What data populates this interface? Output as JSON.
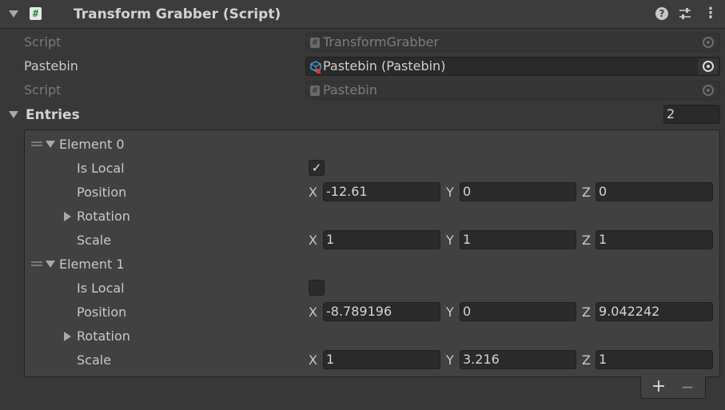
{
  "component": {
    "title": "Transform Grabber (Script)"
  },
  "fields": {
    "script_label": "Script",
    "script_value": "TransformGrabber",
    "pastebin_label": "Pastebin",
    "pastebin_value": "Pastebin (Pastebin)",
    "script2_label": "Script",
    "script2_value": "Pastebin"
  },
  "entries": {
    "label": "Entries",
    "count": "2",
    "elements": [
      {
        "label": "Element 0",
        "is_local_label": "Is Local",
        "is_local": true,
        "position_label": "Position",
        "position": {
          "x": "-12.61",
          "y": "0",
          "z": "0"
        },
        "rotation_label": "Rotation",
        "scale_label": "Scale",
        "scale": {
          "x": "1",
          "y": "1",
          "z": "1"
        }
      },
      {
        "label": "Element 1",
        "is_local_label": "Is Local",
        "is_local": false,
        "position_label": "Position",
        "position": {
          "x": "-8.789196",
          "y": "0",
          "z": "9.042242"
        },
        "rotation_label": "Rotation",
        "scale_label": "Scale",
        "scale": {
          "x": "1",
          "y": "3.216",
          "z": "1"
        }
      }
    ]
  },
  "axes": {
    "x": "X",
    "y": "Y",
    "z": "Z"
  },
  "glyphs": {
    "hash": "#",
    "check": "✓",
    "plus": "+",
    "minus": "−",
    "help": "?",
    "more": "⋮"
  },
  "icons": {
    "foldout": "triangle-down-icon",
    "script": "csharp-script-icon",
    "help": "help-icon",
    "presets": "sliders-icon",
    "menu": "more-vertical-icon",
    "picker": "object-picker-icon",
    "prefab": "prefab-cube-icon",
    "drag": "drag-handle-icon"
  }
}
